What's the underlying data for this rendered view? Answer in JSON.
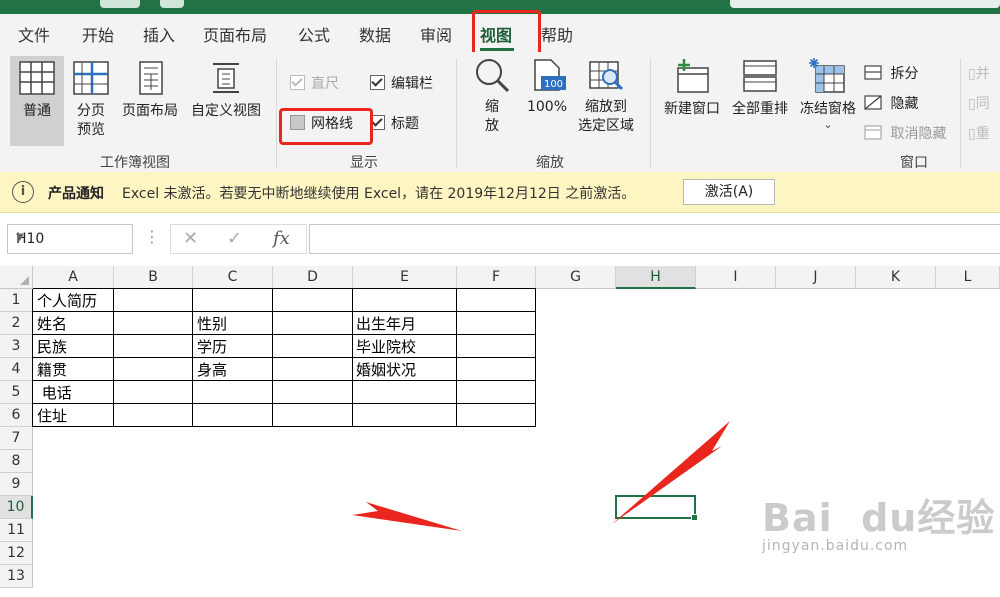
{
  "tabs": [
    {
      "label": "文件"
    },
    {
      "label": "开始"
    },
    {
      "label": "插入"
    },
    {
      "label": "页面布局"
    },
    {
      "label": "公式"
    },
    {
      "label": "数据"
    },
    {
      "label": "审阅"
    },
    {
      "label": "视图",
      "active": true
    },
    {
      "label": "帮助"
    }
  ],
  "ribbon": {
    "workbook_views": {
      "label": "工作簿视图",
      "normal": "普通",
      "page_break_preview": [
        "分页",
        "预览"
      ],
      "page_layout": "页面布局",
      "custom_views": "自定义视图"
    },
    "show": {
      "label": "显示",
      "ruler": {
        "label": "直尺",
        "checked": true,
        "enabled": false
      },
      "formula_bar": {
        "label": "编辑栏",
        "checked": true
      },
      "gridlines": {
        "label": "网格线",
        "checked": false
      },
      "headings": {
        "label": "标题",
        "checked": true
      }
    },
    "zoom": {
      "label": "缩放",
      "zoom_btn": [
        "缩",
        "放"
      ],
      "zoom_100": "100%",
      "icon_100_text": "100",
      "zoom_selection": [
        "缩放到",
        "选定区域"
      ]
    },
    "window": {
      "label": "窗口",
      "new_window": "新建窗口",
      "arrange_all": "全部重排",
      "freeze_panes": "冻结窗格",
      "split": "拆分",
      "hide": "隐藏",
      "unhide": "取消隐藏",
      "partial_1": "并",
      "partial_2": "同",
      "partial_3": "重"
    }
  },
  "notice": {
    "title": "产品通知",
    "message": "Excel 未激活。若要无中断地继续使用 Excel，请在 2019年12月12日 之前激活。",
    "button": "激活(A)"
  },
  "formula_bar": {
    "name_box": "H10",
    "fx": "fx",
    "value": ""
  },
  "sheet": {
    "columns": [
      "A",
      "B",
      "C",
      "D",
      "E",
      "F",
      "G",
      "H",
      "I",
      "J",
      "K",
      "L"
    ],
    "rows": [
      "1",
      "2",
      "3",
      "4",
      "5",
      "6",
      "7",
      "8",
      "9",
      "10",
      "11",
      "12",
      "13"
    ],
    "selected_cell": "H10",
    "cells": {
      "A1": "个人简历",
      "A2": "姓名",
      "C2": "性别",
      "E2": "出生年月",
      "A3": "民族",
      "C3": "学历",
      "E3": "毕业院校",
      "A4": "籍贯",
      "C4": "身高",
      "E4": "婚姻状况",
      "A5": " 电话",
      "A6": "住址"
    }
  },
  "watermark": {
    "brand": "Bai  du经验",
    "url": "jingyan.baidu.com"
  },
  "colors": {
    "excel_green": "#217346",
    "annotation_red": "#e8261e",
    "notice_bg": "#fdf6c3"
  }
}
